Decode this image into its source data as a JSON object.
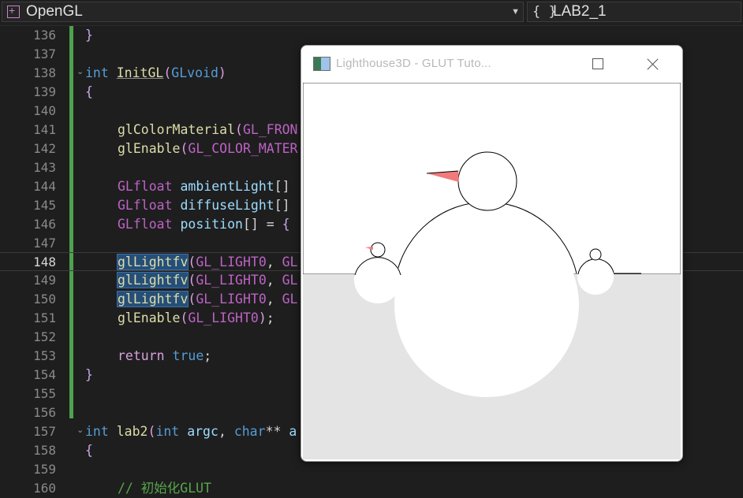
{
  "navbar": {
    "project_name": "OpenGL",
    "scope_icon": "{ }",
    "scope_name": "LAB2_1"
  },
  "editor": {
    "current_line": "148",
    "lines": [
      {
        "num": "136",
        "code": "}"
      },
      {
        "num": "137",
        "code": ""
      },
      {
        "num": "138",
        "code": "int InitGL(GLvoid)"
      },
      {
        "num": "139",
        "code": "{"
      },
      {
        "num": "140",
        "code": ""
      },
      {
        "num": "141",
        "code": "glColorMaterial(GL_FRON"
      },
      {
        "num": "142",
        "code": "glEnable(GL_COLOR_MATER"
      },
      {
        "num": "143",
        "code": ""
      },
      {
        "num": "144",
        "code": "GLfloat ambientLight[]"
      },
      {
        "num": "145",
        "code": "GLfloat diffuseLight[]"
      },
      {
        "num": "146",
        "code": "GLfloat position[] = {"
      },
      {
        "num": "147",
        "code": ""
      },
      {
        "num": "148",
        "code": "glLightfv(GL_LIGHT0, GL"
      },
      {
        "num": "149",
        "code": "glLightfv(GL_LIGHT0, GL"
      },
      {
        "num": "150",
        "code": "glLightfv(GL_LIGHT0, GL"
      },
      {
        "num": "151",
        "code": "glEnable(GL_LIGHT0);"
      },
      {
        "num": "152",
        "code": ""
      },
      {
        "num": "153",
        "code": "return true;"
      },
      {
        "num": "154",
        "code": "}"
      },
      {
        "num": "155",
        "code": ""
      },
      {
        "num": "156",
        "code": ""
      },
      {
        "num": "157",
        "code": "int lab2(int argc, char** a"
      },
      {
        "num": "158",
        "code": "{"
      },
      {
        "num": "159",
        "code": ""
      },
      {
        "num": "160",
        "code": "// 初始化GLUT"
      }
    ]
  },
  "glut_window": {
    "title": "Lighthouse3D - GLUT Tuto...",
    "colors": {
      "sky": "#ffffff",
      "ground": "#e4e4e4",
      "snowman": "#ffffff",
      "outline": "#000000",
      "nose": "#f27a7a"
    }
  }
}
